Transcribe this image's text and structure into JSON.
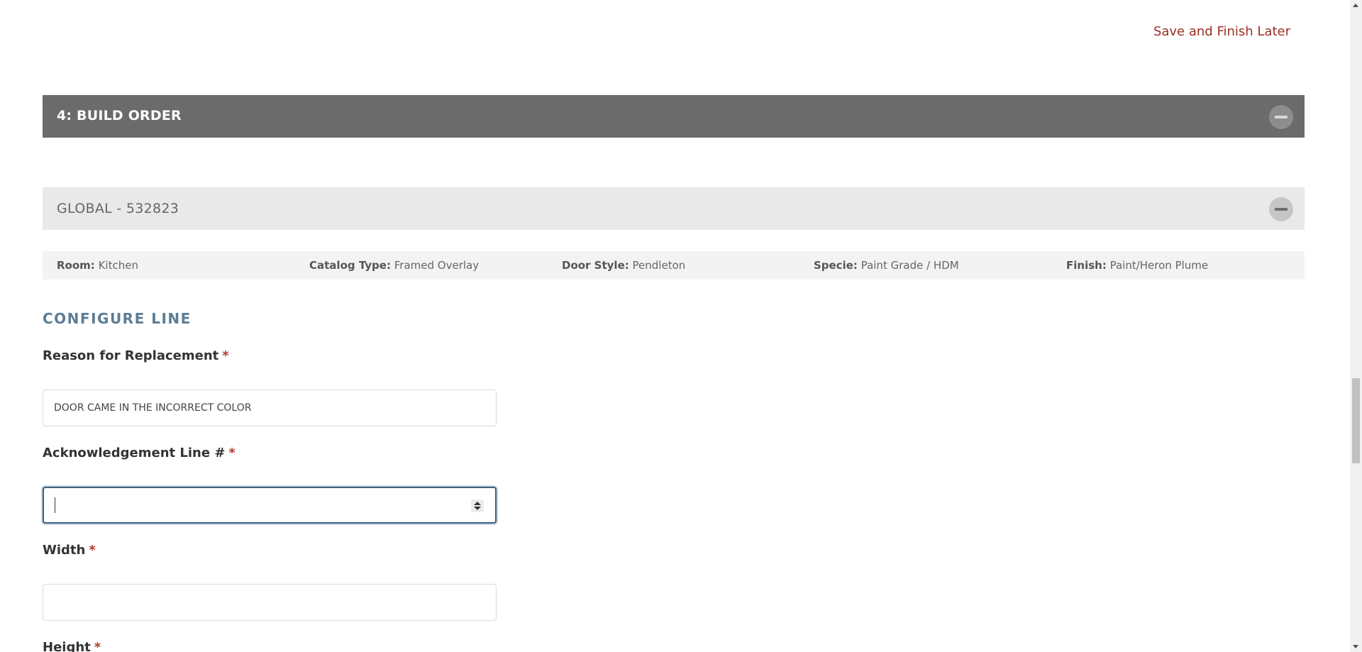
{
  "header": {
    "save_later_label": "Save and Finish Later"
  },
  "build_order": {
    "title": "4: BUILD ORDER"
  },
  "global_section": {
    "title": "GLOBAL - 532823"
  },
  "info": [
    {
      "label": "Room:",
      "value": "Kitchen"
    },
    {
      "label": "Catalog Type:",
      "value": "Framed Overlay"
    },
    {
      "label": "Door Style:",
      "value": "Pendleton"
    },
    {
      "label": "Specie:",
      "value": "Paint Grade / HDM"
    },
    {
      "label": "Finish:",
      "value": "Paint/Heron Plume"
    }
  ],
  "configure": {
    "heading": "CONFIGURE LINE",
    "required_marker": "*",
    "fields": {
      "reason": {
        "label": "Reason for Replacement",
        "value": "DOOR CAME IN THE INCORRECT COLOR"
      },
      "ack_line": {
        "label": "Acknowledgement Line #",
        "value": ""
      },
      "width": {
        "label": "Width",
        "value": ""
      },
      "height": {
        "label": "Height"
      }
    }
  },
  "colors": {
    "accent_link": "#9a2f22",
    "section_heading": "#5c7d96",
    "bar_dark": "#6b6b6b",
    "bar_light": "#e9e9e9",
    "required": "#b53a2a"
  }
}
